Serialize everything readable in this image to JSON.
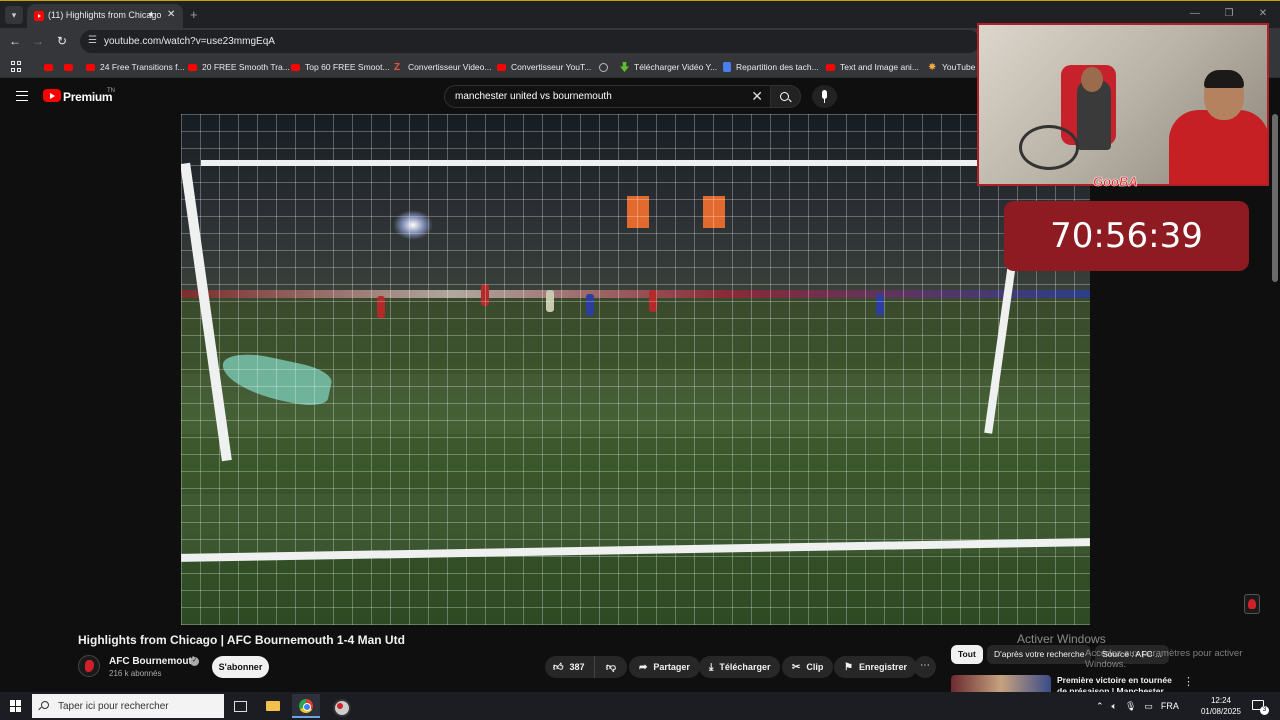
{
  "browser": {
    "tab_title": "(11) Highlights from Chicago",
    "url": "youtube.com/watch?v=use23mmgEqA",
    "bookmarks": [
      {
        "label": "",
        "icon": "youtube-icon"
      },
      {
        "label": "",
        "icon": "youtube-icon"
      },
      {
        "label": "24 Free Transitions f...",
        "icon": "youtube-icon"
      },
      {
        "label": "20 FREE Smooth Tra...",
        "icon": "youtube-icon"
      },
      {
        "label": "Top 60 FREE Smoot...",
        "icon": "youtube-icon"
      },
      {
        "label": "Convertisseur Video...",
        "icon": "z-icon"
      },
      {
        "label": "Convertisseur YouT...",
        "icon": "youtube-icon"
      },
      {
        "label": "",
        "icon": "globe-icon"
      },
      {
        "label": "Télécharger Vidéo Y...",
        "icon": "download-icon"
      },
      {
        "label": "Repartition des tach...",
        "icon": "doc-icon"
      },
      {
        "label": "Text and Image ani...",
        "icon": "youtube-icon"
      },
      {
        "label": "YouTube",
        "icon": "star-icon"
      }
    ]
  },
  "youtube": {
    "brand": "Premium",
    "brand_suffix": "TN",
    "search_query": "manchester united vs bournemouth"
  },
  "overlay": {
    "webcam_tag": "GooBA",
    "timer": "70:56:39"
  },
  "video": {
    "title": "Highlights from Chicago | AFC Bournemouth 1-4 Man Utd",
    "channel_name": "AFC Bournemouth",
    "subscribers": "216 k abonnés",
    "subscribe_label": "S'abonner",
    "likes": "387",
    "share_label": "Partager",
    "download_label": "Télécharger",
    "clip_label": "Clip",
    "save_label": "Enregistrer"
  },
  "watermark": {
    "line1": "Activer Windows",
    "line2": "Accédez aux paramètres pour activer Windows."
  },
  "sidebar": {
    "chips": [
      "Tout",
      "D'après votre recherche",
      "Source : AFC ..."
    ],
    "rec_title": "Première victoire en tournée de présaison | Manchester ..."
  },
  "taskbar": {
    "search_placeholder": "Taper ici pour rechercher",
    "language": "FRA",
    "time": "12:24",
    "date": "01/08/2025",
    "notifications": "3"
  },
  "colors": {
    "accent_red": "#ff0000",
    "timer_bg": "#8e1a22",
    "bg": "#0f0f0f"
  }
}
